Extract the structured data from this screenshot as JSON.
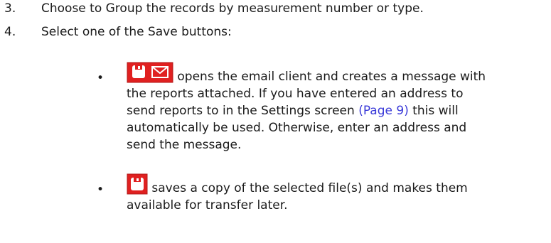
{
  "steps": [
    {
      "number": "3.",
      "text": "Choose to Group the records by measurement number or type."
    },
    {
      "number": "4.",
      "text": "Select one of the Save buttons:"
    }
  ],
  "bullets": [
    {
      "bullet": "•",
      "icon": "save-email-icon",
      "lines": [
        " opens the email client and creates a message with",
        "the reports attached. If you have entered an address to",
        "send reports to in the Settings screen ",
        " this will",
        "automatically be used. Otherwise, enter an address and",
        "send the message."
      ],
      "link_text": "(Page 9)"
    },
    {
      "bullet": "•",
      "icon": "save-icon",
      "lines": [
        " saves a copy of the selected file(s) and makes them",
        "available for transfer later."
      ]
    }
  ],
  "colors": {
    "icon_red": "#e02020",
    "link": "#3a3ad8",
    "text": "#1a1a1a"
  }
}
